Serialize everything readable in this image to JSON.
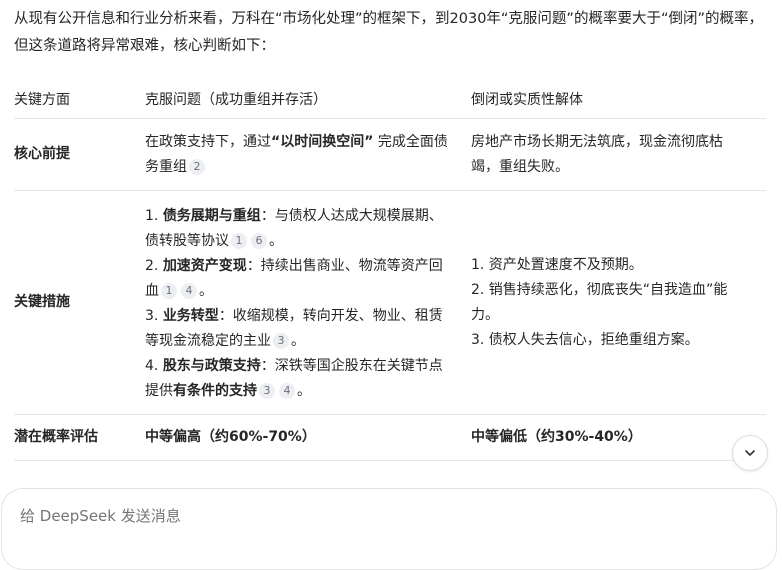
{
  "intro": "从现有公开信息和行业分析来看，万科在“市场化处理”的框架下，到2030年“克服问题”的概率要大于“倒闭”的概率，但这条道路将异常艰难，核心判断如下：",
  "table": {
    "headers": [
      "关键方面",
      "克服问题（成功重组并存活）",
      "倒闭或实质性解体"
    ],
    "row1": {
      "label": "核心前提",
      "overcome_a": "在政策支持下，通过",
      "overcome_bold": "“以时间换空间”",
      "overcome_b": " 完成全面债务重组",
      "overcome_cite": "2",
      "collapse": "房地产市场长期无法筑底，现金流彻底枯竭，重组失败。"
    },
    "row2": {
      "label": "关键措施",
      "m1_num": "1. ",
      "m1_bold": "债务展期与重组",
      "m1_text": "：与债权人达成大规模展期、债转股等协议",
      "m1_cites": [
        "1",
        "6"
      ],
      "m2_num": "2. ",
      "m2_bold": "加速资产变现",
      "m2_text": "：持续出售商业、物流等资产回血",
      "m2_cites": [
        "1",
        "4"
      ],
      "m3_num": "3. ",
      "m3_bold": "业务转型",
      "m3_text": "：收缩规模，转向开发、物业、租赁等现金流稳定的主业",
      "m3_cites": [
        "3"
      ],
      "m4_num": "4. ",
      "m4_bold": "股东与政策支持",
      "m4_text": "：深铁等国企股东在关键节点提供",
      "m4_bold2": "有条件的支持",
      "m4_cites": [
        "3",
        "4"
      ],
      "end_mark": "。",
      "c1": "1. 资产处置速度不及预期。",
      "c2": "2. 销售持续恶化，彻底丧失“自我造血”能力。",
      "c3": "3. 债权人失去信心，拒绝重组方案。"
    },
    "row3": {
      "label": "潜在概率评估",
      "overcome": "中等偏高（约60%-70%）",
      "collapse": "中等偏低（约30%-40%）"
    }
  },
  "composer": {
    "placeholder": "给 DeepSeek 发送消息"
  },
  "icons": {
    "scroll_down": "chevron-down-icon"
  },
  "colors": {
    "cite_bg": "#eceef2",
    "border": "#e6e6e6",
    "text": "#262626"
  }
}
